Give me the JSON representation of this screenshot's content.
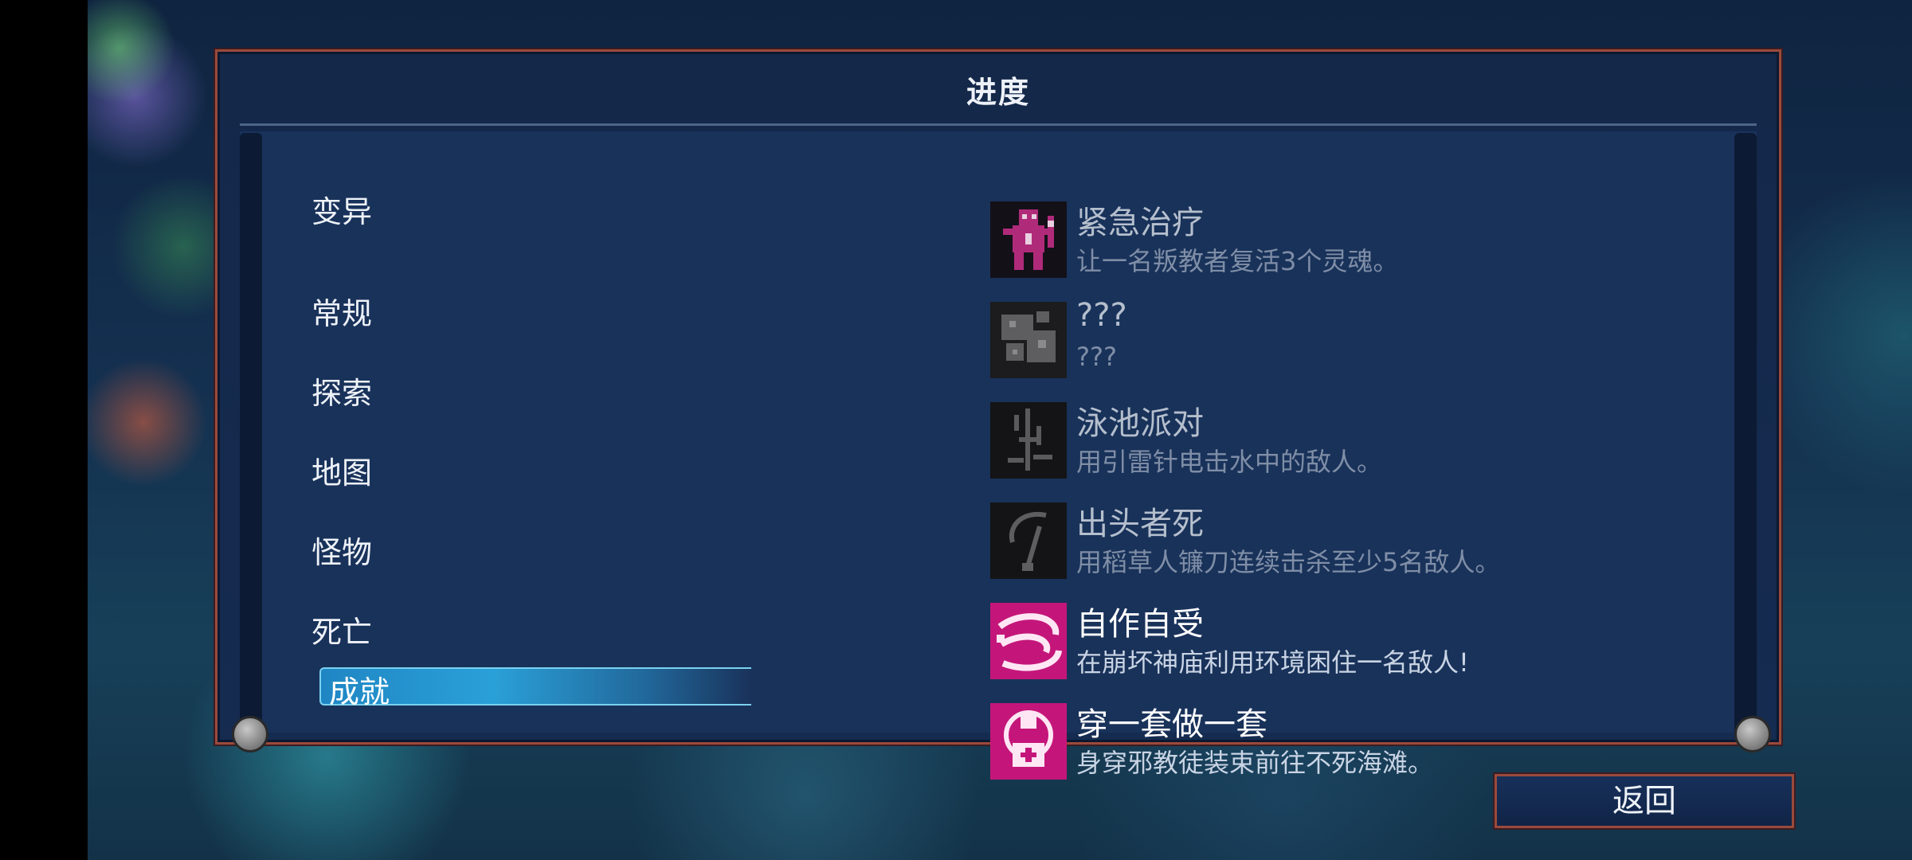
{
  "panel": {
    "title": "进度"
  },
  "categories": [
    {
      "label": "变异"
    },
    {
      "label": "常规"
    },
    {
      "label": "探索"
    },
    {
      "label": "地图"
    },
    {
      "label": "怪物"
    },
    {
      "label": "死亡"
    },
    {
      "label": "成就",
      "selected": true
    }
  ],
  "achievements": [
    {
      "name": "紧急治疗",
      "description": "让一名叛教者复活3个灵魂。",
      "icon": "cultist-heal-icon",
      "unlocked": false
    },
    {
      "name": "???",
      "description": "???",
      "icon": "hidden-achievement-icon",
      "unlocked": false
    },
    {
      "name": "泳池派对",
      "description": "用引雷针电击水中的敌人。",
      "icon": "lightning-rod-icon",
      "unlocked": false
    },
    {
      "name": "出头者死",
      "description": "用稻草人镰刀连续击杀至少5名敌人。",
      "icon": "scythe-icon",
      "unlocked": false
    },
    {
      "name": "自作自受",
      "description": "在崩坏神庙利用环境困住一名敌人!",
      "icon": "trap-swirl-icon",
      "unlocked": true
    },
    {
      "name": "穿一套做一套",
      "description": "身穿邪教徒装束前往不死海滩。",
      "icon": "cultist-outfit-icon",
      "unlocked": true
    }
  ],
  "footer": {
    "back_label": "返回"
  },
  "colors": {
    "frame": "#9a4a3c",
    "selected": "#2aa0d8",
    "icon_magenta": "#e0208a"
  }
}
